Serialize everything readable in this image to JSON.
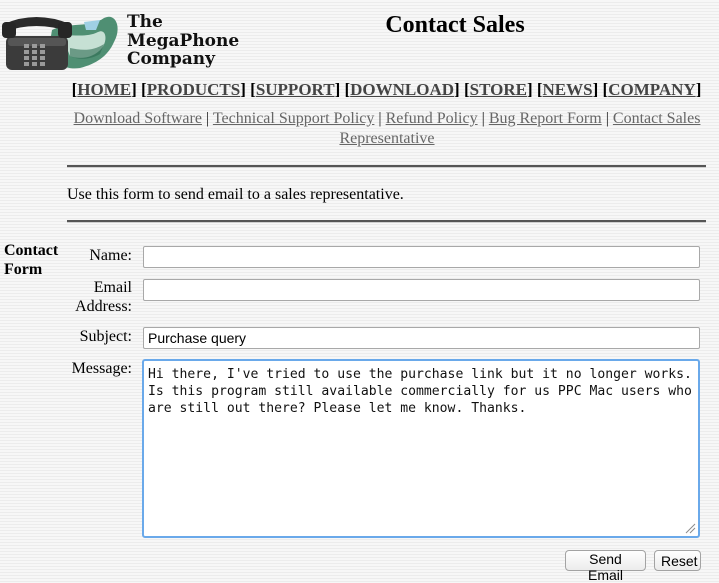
{
  "logo": {
    "line1": "The",
    "line2": "MegaPhone",
    "line3": "Company"
  },
  "page_title": "Contact Sales",
  "main_nav": [
    "HOME",
    "PRODUCTS",
    "SUPPORT",
    "DOWNLOAD",
    "STORE",
    "NEWS",
    "COMPANY"
  ],
  "sub_nav": [
    "Download Software",
    "Technical Support Policy",
    "Refund Policy",
    "Bug Report Form",
    "Contact Sales Representative"
  ],
  "intro": "Use this form to send email to a sales representative.",
  "form": {
    "heading": "Contact Form",
    "name_label": "Name:",
    "name_value": "",
    "email_label": "Email Address:",
    "email_value": "",
    "subject_label": "Subject:",
    "subject_value": "Purchase query",
    "message_label": "Message:",
    "message_value": "Hi there, I've tried to use the purchase link but it no longer works.\nIs this program still available commercially for us PPC Mac users who\nare still out there? Please let me know. Thanks.",
    "send_label": "Send Email",
    "reset_label": "Reset"
  }
}
